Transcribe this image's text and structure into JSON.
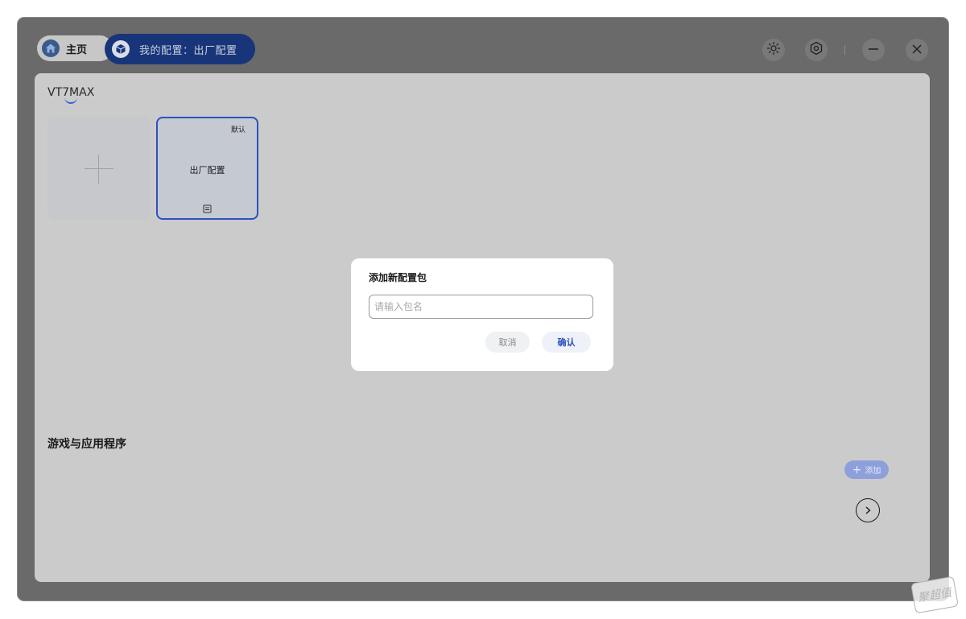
{
  "titlebar": {
    "home_label": "主页",
    "profile_label": "我的配置：出厂配置",
    "icons": [
      "sun-icon",
      "settings-icon",
      "minimize-icon",
      "close-icon"
    ]
  },
  "device": {
    "name": "VT7MAX"
  },
  "profiles": {
    "card_name": "出厂配置",
    "default_badge": "默认"
  },
  "apps_section": {
    "title": "游戏与应用程序",
    "add_label": "添加"
  },
  "dialog": {
    "title": "添加新配置包",
    "input_placeholder": "请输入包名",
    "input_value": "",
    "cancel_label": "取消",
    "confirm_label": "确认"
  },
  "watermark": "聚超值",
  "colors": {
    "accent": "#2a52c0",
    "profile_pill": "#19357a",
    "overlay_bg": "#cbcbcb",
    "dialog_bg": "#ffffff"
  }
}
